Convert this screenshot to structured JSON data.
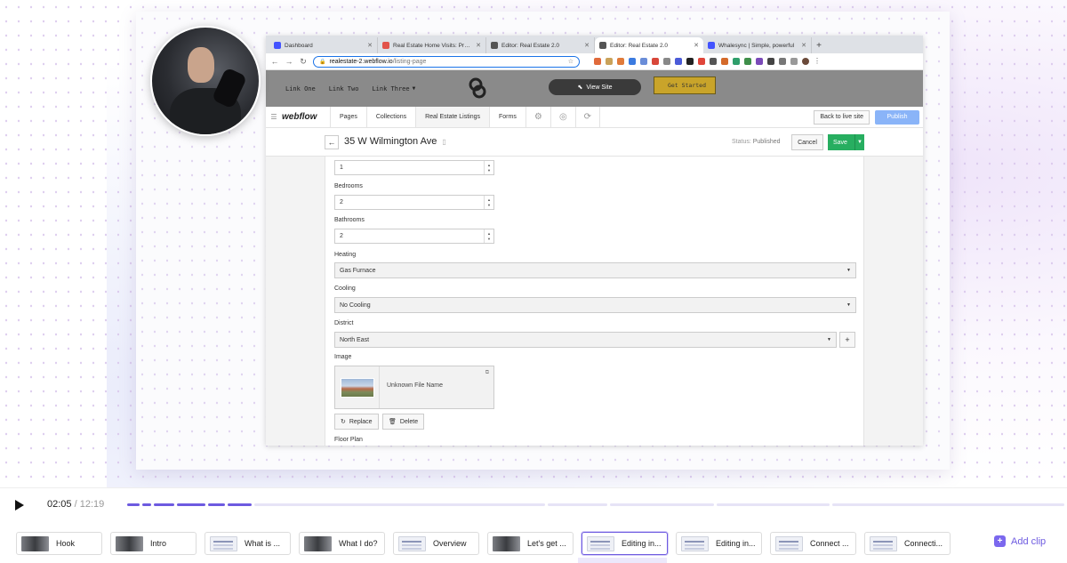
{
  "browser": {
    "tabs": [
      {
        "title": "Dashboard",
        "color": "#4353ff",
        "active": false
      },
      {
        "title": "Real Estate Home Visits: Prope",
        "color": "#e2534a",
        "active": false
      },
      {
        "title": "Editor: Real Estate 2.0",
        "color": "#555555",
        "active": false
      },
      {
        "title": "Editor: Real Estate 2.0",
        "color": "#555555",
        "active": true
      },
      {
        "title": "Whalesync | Simple, powerful",
        "color": "#4353ff",
        "active": false
      }
    ],
    "url_host": "realestate-2.webflow.io",
    "url_path": "/listing-page"
  },
  "site": {
    "nav": [
      "Link One",
      "Link Two",
      "Link Three"
    ],
    "view_site": "View Site",
    "get_started": "Get Started"
  },
  "webflow": {
    "logo": "webflow",
    "tabs": [
      "Pages",
      "Collections",
      "Real Estate Listings",
      "Forms"
    ],
    "back_to_live": "Back to live site",
    "publish": "Publish"
  },
  "item": {
    "title": "35 W Wilmington Ave",
    "status_label": "Status:",
    "status_value": "Published",
    "cancel": "Cancel",
    "save": "Save"
  },
  "form": {
    "first_value": "1",
    "bedrooms_label": "Bedrooms",
    "bedrooms_value": "2",
    "bathrooms_label": "Bathrooms",
    "bathrooms_value": "2",
    "heating_label": "Heating",
    "heating_value": "Gas Furnace",
    "cooling_label": "Cooling",
    "cooling_value": "No Cooling",
    "district_label": "District",
    "district_value": "North East",
    "image_label": "Image",
    "image_name": "Unknown File Name",
    "replace": "Replace",
    "delete": "Delete",
    "floor_plan_label": "Floor Plan"
  },
  "player": {
    "current_time": "02:05",
    "separator": "/",
    "total_time": "12:19",
    "progress_fraction": 0.169,
    "accent_color": "#6d5ae0"
  },
  "clips": [
    {
      "label": "Hook",
      "thumb": "cam",
      "active": false
    },
    {
      "label": "Intro",
      "thumb": "cam",
      "active": false
    },
    {
      "label": "What is ...",
      "thumb": "scr",
      "active": false
    },
    {
      "label": "What I do?",
      "thumb": "cam",
      "active": false
    },
    {
      "label": "Overview",
      "thumb": "scr",
      "active": false
    },
    {
      "label": "Let's get ...",
      "thumb": "cam",
      "active": false
    },
    {
      "label": "Editing in...",
      "thumb": "scr",
      "active": true
    },
    {
      "label": "Editing in...",
      "thumb": "scr",
      "active": false
    },
    {
      "label": "Connect ...",
      "thumb": "scr",
      "active": false
    },
    {
      "label": "Connecti...",
      "thumb": "scr",
      "active": false
    }
  ],
  "add_clip": "Add clip"
}
